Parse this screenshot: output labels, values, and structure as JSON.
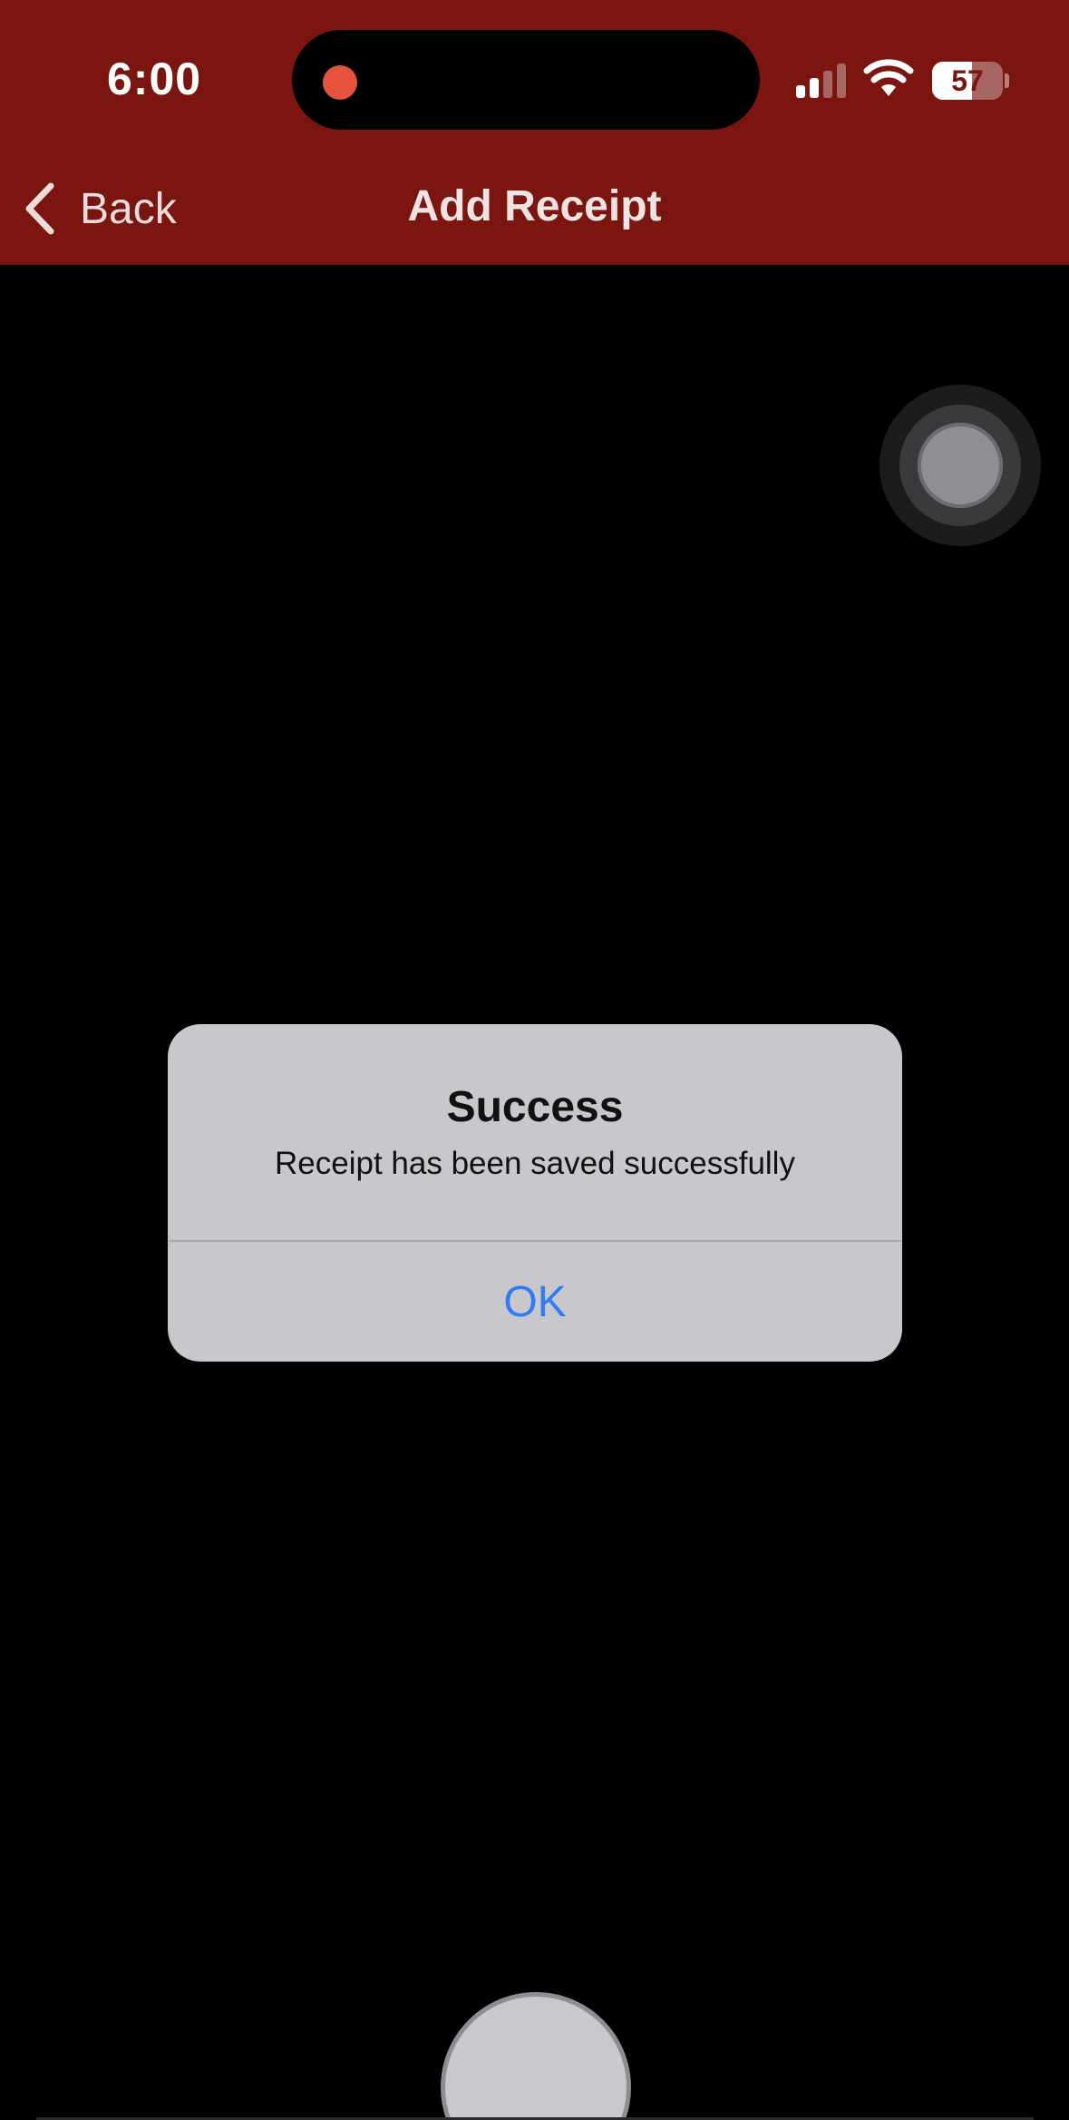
{
  "status_bar": {
    "time": "6:00",
    "battery_level": "57",
    "recording_indicator_color": "#e5533f"
  },
  "nav": {
    "back_label": "Back",
    "title": "Add Receipt",
    "background_color": "#7a1510"
  },
  "alert": {
    "title": "Success",
    "message": "Receipt has been saved successfully",
    "ok_label": "OK",
    "ok_color": "#2f7cf6"
  },
  "camera": {
    "shutter": "shutter-button",
    "assistive_touch": "assistive-touch-button"
  }
}
